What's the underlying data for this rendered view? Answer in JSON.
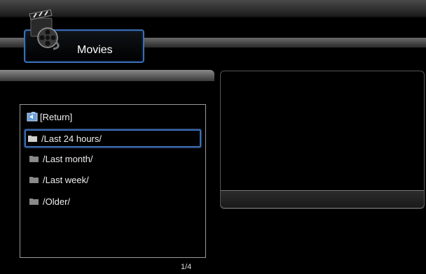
{
  "header": {
    "title": "Movies",
    "icon": "movie-clapper-film-reel-icon"
  },
  "list": {
    "items": [
      {
        "label": "[Return]",
        "icon": "return-folder-icon"
      },
      {
        "label": "/Last 24 hours/",
        "icon": "folder-icon",
        "selected": true
      },
      {
        "label": "/Last month/",
        "icon": "folder-icon"
      },
      {
        "label": "/Last week/",
        "icon": "folder-icon"
      },
      {
        "label": "/Older/",
        "icon": "folder-icon"
      }
    ],
    "page": "1/4"
  },
  "colors": {
    "accent": "#3a6fb8",
    "background": "#000000"
  }
}
